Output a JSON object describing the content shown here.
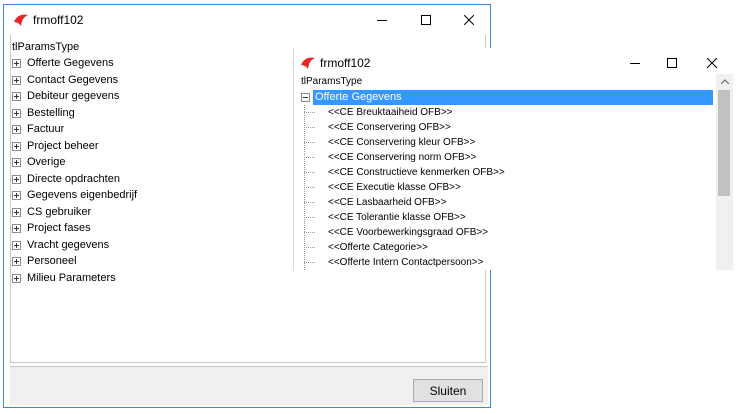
{
  "window1": {
    "title": "frmoff102",
    "tree_root": "tlParamsType",
    "items": [
      "Offerte Gegevens",
      "Contact Gegevens",
      "Debiteur gegevens",
      "Bestelling",
      "Factuur",
      "Project beheer",
      "Overige",
      "Directe opdrachten",
      "Gegevens eigenbedrijf",
      "CS gebruiker",
      "Project fases",
      "Vracht gegevens",
      "Personeel",
      "Milieu Parameters"
    ],
    "close_button_label": "Sluiten"
  },
  "window2": {
    "title": "frmoff102",
    "tree_root": "tlParamsType",
    "selected_item": "Offerte Gegevens",
    "children": [
      "<<CE Breuktaaiheid OFB>>",
      "<<CE Conservering OFB>>",
      "<<CE Conservering kleur OFB>>",
      "<<CE Conservering norm OFB>>",
      "<<CE Constructieve kenmerken OFB>>",
      "<<CE Executie klasse OFB>>",
      "<<CE Lasbaarheid OFB>>",
      "<<CE Tolerantie klasse OFB>>",
      "<<CE Voorbewerkingsgraad OFB>>",
      "<<Offerte Categorie>>",
      "<<Offerte Intern Contactpersoon>>"
    ]
  },
  "colors": {
    "selection": "#3398ff",
    "window_border": "#3c89d0",
    "app_icon": "#e8262a"
  },
  "icons": [
    "app-logo-icon",
    "minimize-icon",
    "maximize-icon",
    "close-icon",
    "expand-icon",
    "collapse-icon",
    "scroll-up-icon"
  ]
}
